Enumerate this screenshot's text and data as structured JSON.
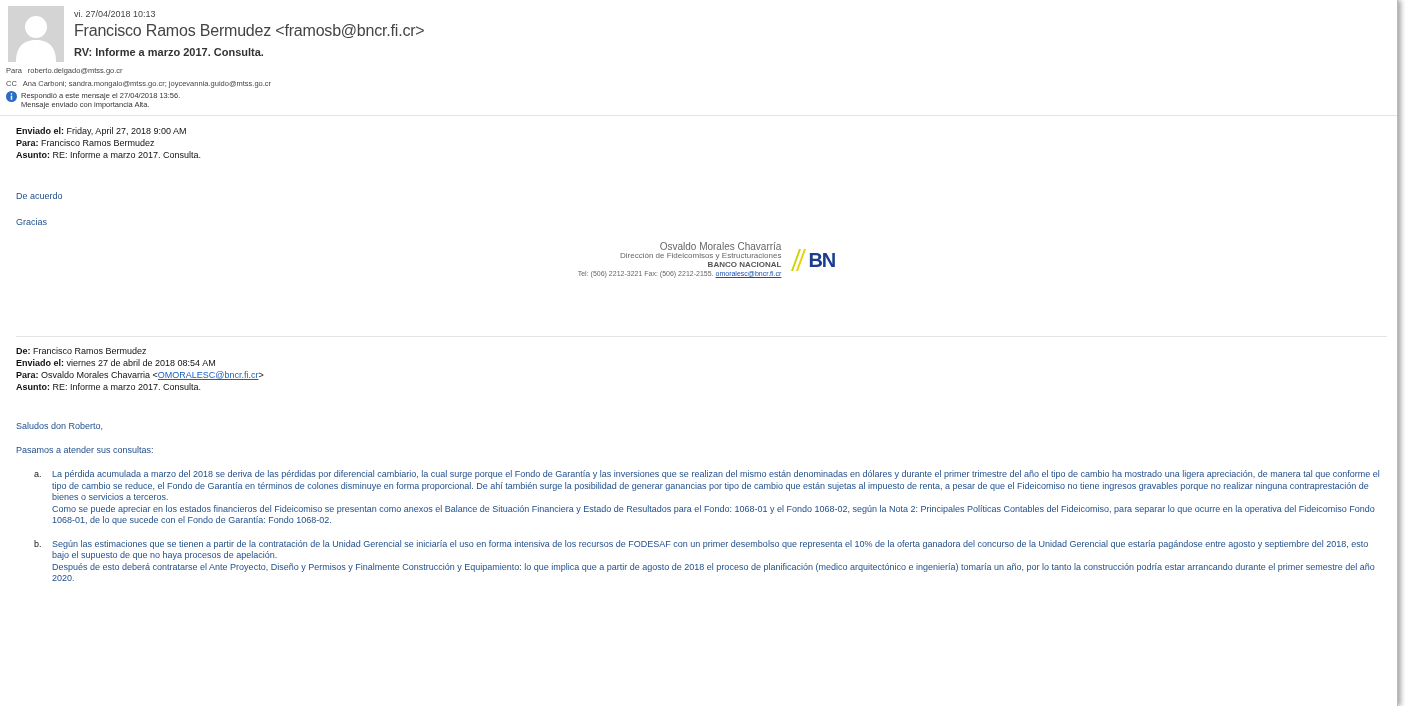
{
  "header": {
    "date": "vi. 27/04/2018 10:13",
    "sender": "Francisco Ramos Bermudez <framosb@bncr.fi.cr>",
    "subject": "RV: Informe a marzo 2017. Consulta.",
    "recipients": [
      {
        "label": "Para",
        "value": "roberto.delgado@mtss.go.cr"
      },
      {
        "label": "CC",
        "value": "Ana Carboni; sandra.mongalo@mtss.go.cr; joycevannia.guido@mtss.go.cr"
      }
    ],
    "info": [
      "Respondió a este mensaje el 27/04/2018 13:56.",
      "Mensaje enviado con importancia Alta."
    ]
  },
  "reply": {
    "fields": [
      {
        "label": "Enviado el:",
        "value": "Friday, April 27, 2018 9:00 AM"
      },
      {
        "label": "Para:",
        "value": "Francisco Ramos Bermudez"
      },
      {
        "label": "Asunto:",
        "value": "RE: Informe a marzo 2017. Consulta."
      }
    ],
    "body": [
      "De acuerdo",
      "Gracias"
    ],
    "signature": {
      "name": "Osvaldo Morales Chavarría",
      "department": "Dirección de Fideicomisos y Estructuraciones",
      "bank": "BANCO NACIONAL",
      "contact": "Tel: (506) 2212-3221 Fax: (506) 2212-2155.",
      "email": "omoralesc@bncr.fi.cr",
      "logo": "BN"
    }
  },
  "original": {
    "fields": [
      {
        "label": "De:",
        "value": "Francisco Ramos Bermudez"
      },
      {
        "label": "Enviado el:",
        "value": "viernes 27 de abril de 2018 08:54 AM"
      },
      {
        "label": "Para:",
        "value": "Osvaldo Morales Chavarria <",
        "link": "OMORALESC@bncr.fi.cr",
        "after": ">"
      },
      {
        "label": "Asunto:",
        "value": "RE: Informe a marzo 2017. Consulta."
      }
    ],
    "greeting": "Saludos don Roberto,",
    "intro": "Pasamos a atender sus consultas:",
    "items": [
      {
        "marker": "a.",
        "paragraphs": [
          "La pérdida acumulada a marzo del 2018 se deriva de las pérdidas por diferencial cambiario, la cual surge porque el Fondo de Garantía y las inversiones que se realizan del mismo están denominadas en dólares y durante el primer trimestre del año el tipo de cambio ha mostrado una ligera apreciación, de manera tal que conforme el tipo de cambio se reduce, el Fondo de Garantía en términos de colones disminuye en forma proporcional. De ahí también surge la posibilidad de generar ganancias por tipo de cambio que están sujetas al impuesto de renta, a pesar de que el Fideicomiso no tiene ingresos gravables porque no realizar ninguna contraprestación de bienes o servicios a terceros.",
          "Como se puede apreciar en los estados financieros del Fideicomiso se presentan como anexos el Balance de Situación Financiera y Estado de Resultados para el  Fondo: 1068-01 y el Fondo 1068-02, según la Nota 2: Principales Políticas Contables del Fideicomiso, para separar lo que ocurre en la operativa del Fideicomiso Fondo 1068-01, de lo que sucede con el Fondo de Garantía: Fondo 1068-02."
        ]
      },
      {
        "marker": "b.",
        "paragraphs": [
          "Según las estimaciones que se tienen a partir de la contratación de la Unidad Gerencial se iniciaría el uso en forma intensiva de los recursos de FODESAF con un primer desembolso que representa el 10% de la oferta ganadora del concurso de la Unidad Gerencial que estaría pagándose entre agosto y septiembre del 2018, esto bajo el supuesto de que no haya procesos de apelación.",
          "Después de esto deberá contratarse el Ante Proyecto, Diseño y Permisos y Finalmente Construcción y Equipamiento: lo que implica que a partir de agosto de 2018 el proceso de planificación (medico arquitectónico e ingeniería) tomaría un año, por lo tanto la construcción podría estar arrancando durante el primer semestre del año 2020."
        ]
      }
    ]
  }
}
